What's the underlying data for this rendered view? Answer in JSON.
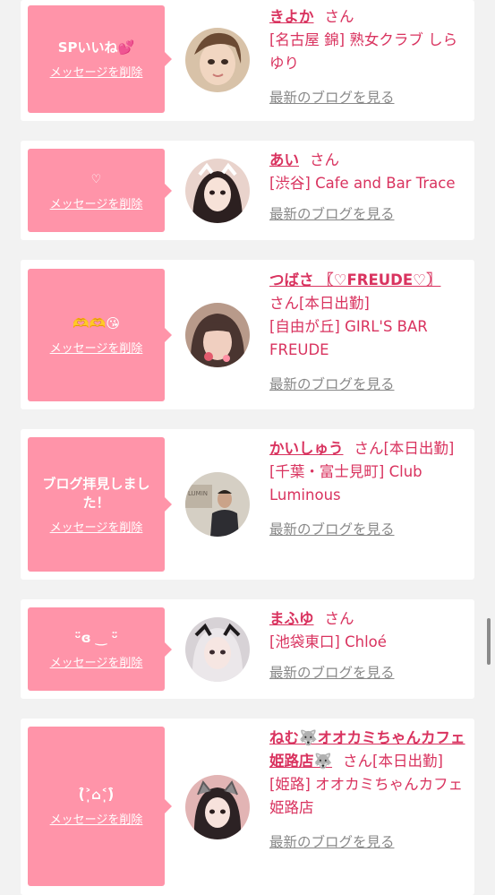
{
  "delete_label": "メッセージを削除",
  "san_label": "さん",
  "blog_label": "最新のブログを見る",
  "entries": [
    {
      "message": "SPいいね💕",
      "name": "きよか",
      "suffix": "",
      "shop": "[名古屋 錦] 熟女クラブ しらゆり"
    },
    {
      "message": "♡",
      "name": "あい",
      "suffix": "",
      "shop": "[渋谷] Cafe and Bar Trace"
    },
    {
      "message": "🫶🫶😘",
      "name": "つばさ 〖♡FREUDE♡〗",
      "suffix": "[本日出勤]",
      "shop": "[自由が丘] GIRL'S BAR FREUDE"
    },
    {
      "message": "ブログ拝見しました！",
      "name": "かいしゅう",
      "suffix": "[本日出勤]",
      "shop": "[千葉・富士見町] Club Luminous"
    },
    {
      "message": "ᵕ̈ɞ ‿ ᵕ̈",
      "name": "まふゆ",
      "suffix": "",
      "shop": "[池袋東口] Chloé"
    },
    {
      "message": "(͒˃̩̩⌂˂̩̩)͒",
      "name": "ねむ🐺オオカミちゃんカフェ姫路店🐺",
      "suffix": "[本日出勤]",
      "shop": "[姫路] オオカミちゃんカフェ姫路店"
    }
  ],
  "colors": {
    "bubble": "#ff94a9",
    "accent": "#d9335f",
    "link_gray": "#888888",
    "background": "#f2f2f2"
  }
}
